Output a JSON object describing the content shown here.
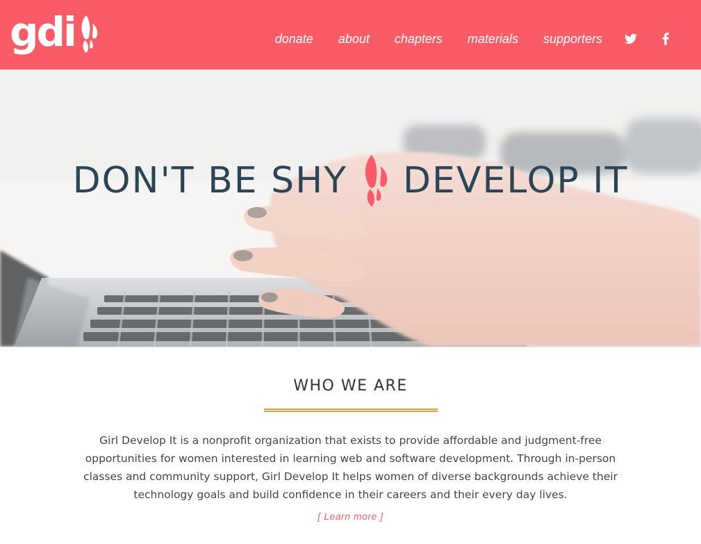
{
  "brand": {
    "name": "gdi",
    "accent_color": "#f95c67",
    "heading_color": "#2b4557",
    "rule_color": "#cfa24d"
  },
  "header": {
    "logo_text": "gdi",
    "nav": [
      {
        "label": "donate"
      },
      {
        "label": "about"
      },
      {
        "label": "chapters"
      },
      {
        "label": "materials"
      },
      {
        "label": "supporters"
      }
    ],
    "social": [
      {
        "icon": "twitter-icon"
      },
      {
        "icon": "facebook-icon"
      }
    ]
  },
  "hero": {
    "title_left": "DON'T BE SHY",
    "title_right": "DEVELOP IT",
    "background": "photo of hands typing on a laptop keyboard"
  },
  "about": {
    "heading": "WHO WE ARE",
    "body": "Girl Develop It is a nonprofit organization that exists to provide affordable and judgment-free opportunities for women interested in learning web and software development. Through in-person classes and community support, Girl Develop It helps women of diverse backgrounds achieve their technology goals and build confidence in their careers and their every day lives.",
    "learn_more": "[ Learn more ]"
  }
}
